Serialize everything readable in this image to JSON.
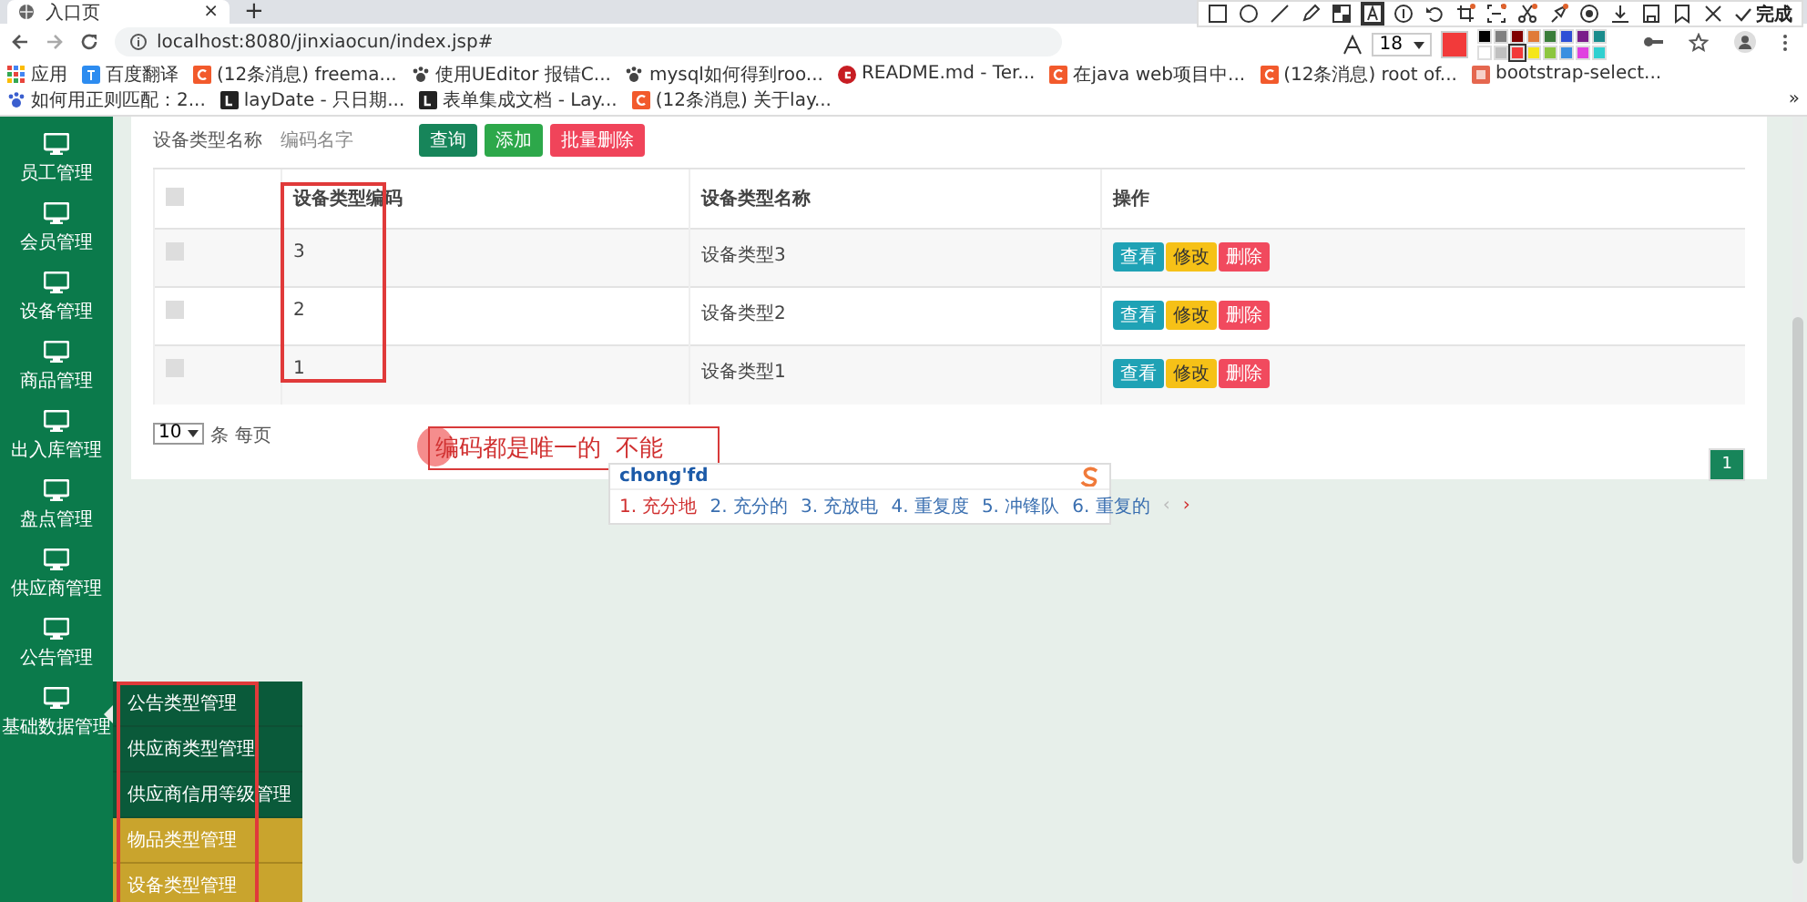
{
  "browser": {
    "tab_title": "入口页",
    "tab_close": "×",
    "new_tab": "+",
    "url": "localhost:8080/jinxiaocun/index.jsp#",
    "bookmarks": [
      {
        "label": "应用",
        "kind": "apps"
      },
      {
        "label": "百度翻译",
        "kind": "blue"
      },
      {
        "label": "(12条消息) freema...",
        "kind": "csdn"
      },
      {
        "label": "使用UEditor 报错C...",
        "kind": "paw"
      },
      {
        "label": "mysql如何得到roo...",
        "kind": "paw"
      },
      {
        "label": "README.md - Ter...",
        "kind": "gitee"
      },
      {
        "label": "在java web项目中...",
        "kind": "csdn"
      },
      {
        "label": "(12条消息) root of...",
        "kind": "csdn"
      },
      {
        "label": "bootstrap-select...",
        "kind": "orange"
      },
      {
        "label": "如何用正则匹配：2...",
        "kind": "baidu"
      },
      {
        "label": "layDate - 只日期...",
        "kind": "layui"
      },
      {
        "label": "表单集成文档 - Lay...",
        "kind": "layui"
      },
      {
        "label": "(12条消息) 关于lay...",
        "kind": "csdn"
      }
    ],
    "more": "»"
  },
  "annotation_toolbar": {
    "tools": [
      {
        "kind": "rect",
        "selected": false
      },
      {
        "kind": "circle",
        "selected": false
      },
      {
        "kind": "line",
        "selected": false
      },
      {
        "kind": "pencil",
        "selected": false
      },
      {
        "kind": "mosaic",
        "selected": false
      },
      {
        "kind": "text",
        "selected": true
      },
      {
        "kind": "number",
        "selected": false
      },
      {
        "kind": "undo",
        "selected": false
      },
      {
        "kind": "crop",
        "selected": false
      },
      {
        "kind": "ocr",
        "selected": false
      },
      {
        "kind": "scissors",
        "selected": false
      },
      {
        "kind": "pin",
        "selected": false
      },
      {
        "kind": "record",
        "selected": false
      },
      {
        "kind": "download",
        "selected": false
      },
      {
        "kind": "save",
        "selected": false
      },
      {
        "kind": "bookmark",
        "selected": false
      },
      {
        "kind": "close",
        "selected": false
      }
    ],
    "done_label": "完成",
    "font_size": "18",
    "palette": [
      {
        "color": "#000000",
        "selected": false
      },
      {
        "color": "#808080",
        "selected": false
      },
      {
        "color": "#800000",
        "selected": false
      },
      {
        "color": "#e07b39",
        "selected": false
      },
      {
        "color": "#3a7d3a",
        "selected": false
      },
      {
        "color": "#2d4fd6",
        "selected": false
      },
      {
        "color": "#7a1f8a",
        "selected": false
      },
      {
        "color": "#1a8c8c",
        "selected": false
      },
      {
        "color": "#ffffff",
        "selected": false
      },
      {
        "color": "#c0c0c0",
        "selected": false
      },
      {
        "color": "#f23a3a",
        "selected": true
      },
      {
        "color": "#f5e61a",
        "selected": false
      },
      {
        "color": "#8cc63f",
        "selected": false
      },
      {
        "color": "#3a8fe0",
        "selected": false
      },
      {
        "color": "#e040e0",
        "selected": false
      },
      {
        "color": "#30d0d0",
        "selected": false
      }
    ]
  },
  "sidebar": {
    "items": [
      {
        "label": "员工管理",
        "expanded": false
      },
      {
        "label": "会员管理",
        "expanded": false
      },
      {
        "label": "设备管理",
        "expanded": false
      },
      {
        "label": "商品管理",
        "expanded": false
      },
      {
        "label": "出入库管理",
        "expanded": false
      },
      {
        "label": "盘点管理",
        "expanded": false
      },
      {
        "label": "供应商管理",
        "expanded": false
      },
      {
        "label": "公告管理",
        "expanded": false
      },
      {
        "label": "基础数据管理",
        "expanded": true,
        "children": [
          {
            "label": "公告类型管理",
            "highlighted": false
          },
          {
            "label": "供应商类型管理",
            "highlighted": false
          },
          {
            "label": "供应商信用等级管理",
            "highlighted": false
          },
          {
            "label": "物品类型管理",
            "highlighted": true
          },
          {
            "label": "设备类型管理",
            "highlighted": true
          }
        ]
      }
    ]
  },
  "search": {
    "label": "设备类型名称",
    "placeholder": "编码名字",
    "buttons": [
      {
        "label": "查询",
        "kind": "primary"
      },
      {
        "label": "添加",
        "kind": "success"
      },
      {
        "label": "批量删除",
        "kind": "danger"
      }
    ]
  },
  "table": {
    "columns": [
      {
        "kind": "checkbox",
        "checked": false
      },
      {
        "kind": "text",
        "label": "设备类型编码"
      },
      {
        "kind": "text",
        "label": "设备类型名称"
      },
      {
        "kind": "text",
        "label": "操作"
      }
    ],
    "rows": [
      {
        "checked": false,
        "code": "3",
        "name": "设备类型3",
        "actions": [
          {
            "label": "查看",
            "kind": "info"
          },
          {
            "label": "修改",
            "kind": "warning"
          },
          {
            "label": "删除",
            "kind": "danger"
          }
        ]
      },
      {
        "checked": false,
        "code": "2",
        "name": "设备类型2",
        "actions": [
          {
            "label": "查看",
            "kind": "info"
          },
          {
            "label": "修改",
            "kind": "warning"
          },
          {
            "label": "删除",
            "kind": "danger"
          }
        ]
      },
      {
        "checked": false,
        "code": "1",
        "name": "设备类型1",
        "actions": [
          {
            "label": "查看",
            "kind": "info"
          },
          {
            "label": "修改",
            "kind": "warning"
          },
          {
            "label": "删除",
            "kind": "danger"
          }
        ]
      }
    ]
  },
  "pager": {
    "page_size": "10",
    "per_page_label": "条 每页",
    "pages": [
      {
        "label": "1",
        "selected": true
      }
    ]
  },
  "annotation": {
    "text": "编码都是唯一的  不能"
  },
  "ime": {
    "input": "chong'fd",
    "candidates": [
      {
        "label": "1. 充分地",
        "selected": true
      },
      {
        "label": "2. 充分的",
        "selected": false
      },
      {
        "label": "3. 充放电",
        "selected": false
      },
      {
        "label": "4. 重复度",
        "selected": false
      },
      {
        "label": "5. 冲锋队",
        "selected": false
      },
      {
        "label": "6. 重复的",
        "selected": false
      }
    ],
    "prev": "‹",
    "next": "›"
  }
}
